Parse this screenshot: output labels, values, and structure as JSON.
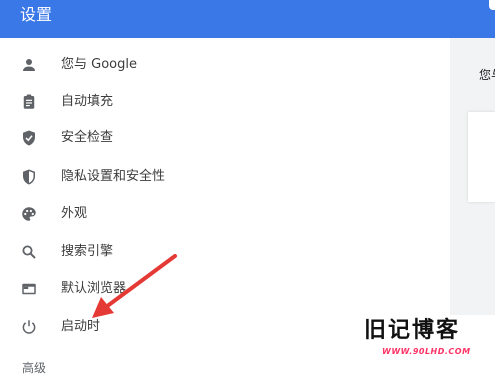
{
  "header": {
    "title": "设置"
  },
  "sidebar": {
    "items": [
      {
        "label": "您与 Google",
        "icon": "person-icon"
      },
      {
        "label": "自动填充",
        "icon": "clipboard-icon"
      },
      {
        "label": "安全检查",
        "icon": "shield-check-icon"
      },
      {
        "label": "隐私设置和安全性",
        "icon": "shield-half-icon"
      },
      {
        "label": "外观",
        "icon": "palette-icon"
      },
      {
        "label": "搜索引擎",
        "icon": "search-icon"
      },
      {
        "label": "默认浏览器",
        "icon": "browser-window-icon"
      },
      {
        "label": "启动时",
        "icon": "power-icon"
      }
    ],
    "partial_label": "高级"
  },
  "main": {
    "truncated_text": "您与"
  },
  "watermark": {
    "title": "旧记博客",
    "subtitle": "WWW.90LHD.COM"
  },
  "colors": {
    "header_bg": "#3b78e7",
    "annotation_arrow": "#e53935",
    "icon": "#5f6368"
  }
}
